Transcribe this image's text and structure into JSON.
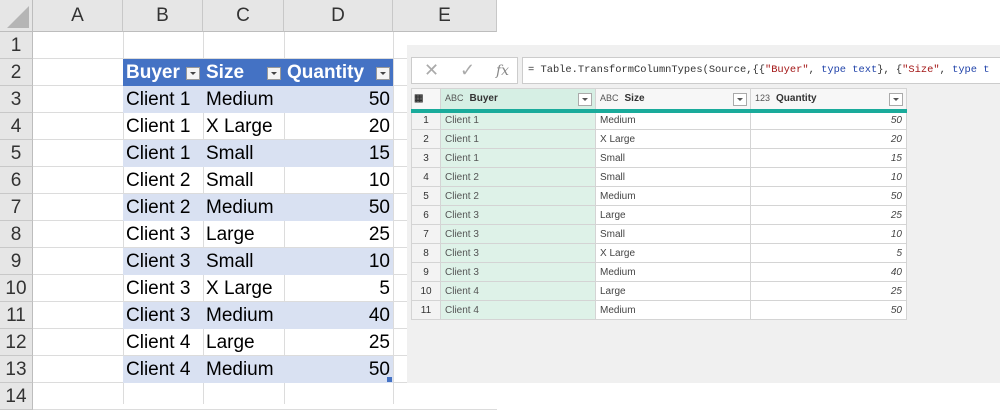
{
  "excel": {
    "columns": [
      "A",
      "B",
      "C",
      "D",
      "E"
    ],
    "rows": [
      "1",
      "2",
      "3",
      "4",
      "5",
      "6",
      "7",
      "8",
      "9",
      "10",
      "11",
      "12",
      "13",
      "14"
    ],
    "headers": [
      "Buyer",
      "Size",
      "Quantity"
    ],
    "data": [
      [
        "Client 1",
        "Medium",
        "50"
      ],
      [
        "Client 1",
        "X Large",
        "20"
      ],
      [
        "Client 1",
        "Small",
        "15"
      ],
      [
        "Client 2",
        "Small",
        "10"
      ],
      [
        "Client 2",
        "Medium",
        "50"
      ],
      [
        "Client 3",
        "Large",
        "25"
      ],
      [
        "Client 3",
        "Small",
        "10"
      ],
      [
        "Client 3",
        "X Large",
        "5"
      ],
      [
        "Client 3",
        "Medium",
        "40"
      ],
      [
        "Client 4",
        "Large",
        "25"
      ],
      [
        "Client 4",
        "Medium",
        "50"
      ]
    ]
  },
  "power_query": {
    "formula_prefix": "= Table.TransformColumnTypes(Source,{{",
    "formula_s1": "\"Buyer\"",
    "formula_mid1": ", ",
    "formula_kw1": "type text",
    "formula_mid2": "}, {",
    "formula_s2": "\"Size\"",
    "formula_mid3": ", ",
    "formula_kw2": "type t",
    "fx_label": "fx",
    "cancel_glyph": "✕",
    "confirm_glyph": "✓",
    "columns": [
      {
        "type": "ABC",
        "name": "Buyer"
      },
      {
        "type": "ABC",
        "name": "Size"
      },
      {
        "type": "123",
        "name": "Quantity"
      }
    ],
    "rows": [
      [
        "1",
        "Client 1",
        "Medium",
        "50"
      ],
      [
        "2",
        "Client 1",
        "X Large",
        "20"
      ],
      [
        "3",
        "Client 1",
        "Small",
        "15"
      ],
      [
        "4",
        "Client 2",
        "Small",
        "10"
      ],
      [
        "5",
        "Client 2",
        "Medium",
        "50"
      ],
      [
        "6",
        "Client 3",
        "Large",
        "25"
      ],
      [
        "7",
        "Client 3",
        "Small",
        "10"
      ],
      [
        "8",
        "Client 3",
        "X Large",
        "5"
      ],
      [
        "9",
        "Client 3",
        "Medium",
        "40"
      ],
      [
        "10",
        "Client 4",
        "Large",
        "25"
      ],
      [
        "11",
        "Client 4",
        "Medium",
        "50"
      ]
    ]
  }
}
